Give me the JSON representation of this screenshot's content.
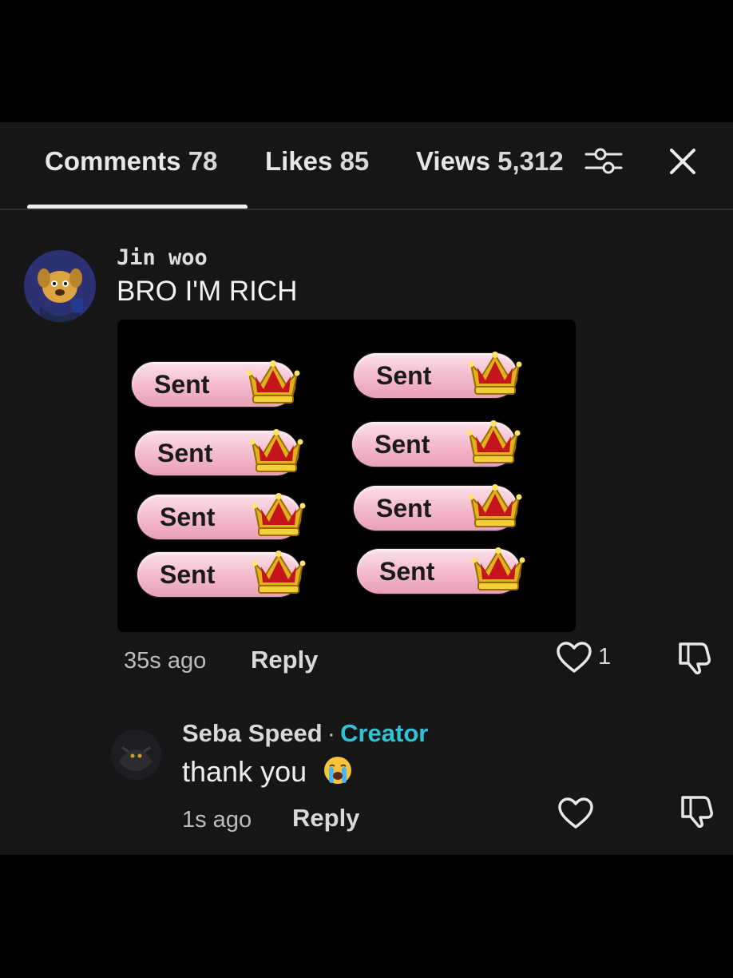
{
  "tabs": {
    "comments_label": "Comments",
    "comments_count": "78",
    "likes_label": "Likes",
    "likes_count": "85",
    "views_label": "Views",
    "views_count": "5,312"
  },
  "icons": {
    "filter": "sliders-icon",
    "close": "close-icon",
    "like": "heart-icon",
    "dislike": "thumbs-down-icon",
    "emoji": "loudly-crying-face-emoji"
  },
  "comments": [
    {
      "username": "Jin woo",
      "text": "BRO I'M RICH",
      "time": "35s ago",
      "reply_label": "Reply",
      "like_count": "1",
      "gifts": [
        "Sent",
        "Sent",
        "Sent",
        "Sent",
        "Sent",
        "Sent",
        "Sent",
        "Sent"
      ]
    },
    {
      "username": "Seba Speed",
      "badge": "Creator",
      "separator": "·",
      "text": "thank you",
      "time": "1s ago",
      "reply_label": "Reply"
    }
  ],
  "colors": {
    "background": "#000000",
    "panel": "#161616",
    "creator_badge": "#2ec4d6",
    "pill_pink": "#f3b9cc"
  }
}
